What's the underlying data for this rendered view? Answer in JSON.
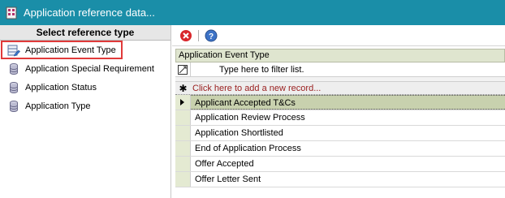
{
  "window": {
    "title": "Application reference data...",
    "accent_color": "#1a8ea8"
  },
  "left_panel": {
    "header": "Select reference type",
    "items": [
      {
        "label": "Application Event Type",
        "icon": "edit-table-icon",
        "selected": true
      },
      {
        "label": "Application Special Requirement",
        "icon": "database-icon"
      },
      {
        "label": "Application Status",
        "icon": "database-icon"
      },
      {
        "label": "Application Type",
        "icon": "database-icon"
      }
    ]
  },
  "toolbar": {
    "delete_icon": "delete-icon",
    "help_icon": "help-icon"
  },
  "grid": {
    "column_header": "Application Event Type",
    "filter_placeholder": "Type here to filter list.",
    "new_record_text": "Click here to add a new record...",
    "rows": [
      "Applicant Accepted T&Cs",
      "Application Review Process",
      "Application Shortlisted",
      "End of Application Process",
      "Offer Accepted",
      "Offer Letter Sent"
    ]
  }
}
